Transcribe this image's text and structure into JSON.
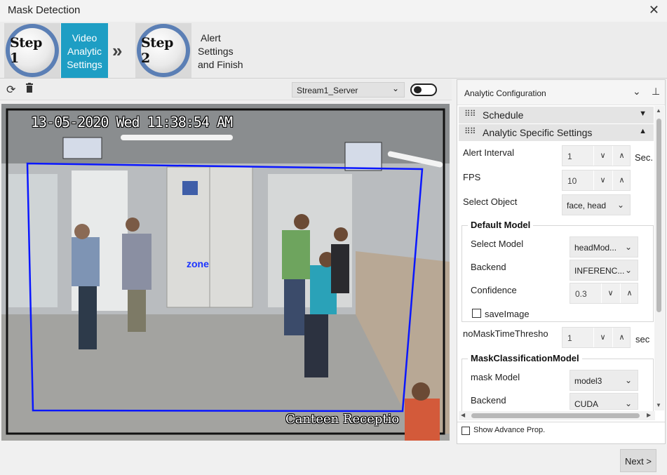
{
  "window": {
    "title": "Mask Detection"
  },
  "steps": [
    {
      "badge": "Step 1",
      "label_lines": [
        "Video",
        "Analytic",
        "Settings"
      ]
    },
    {
      "badge": "Step 2",
      "label_lines": [
        "Alert",
        "Settings",
        "and Finish"
      ]
    }
  ],
  "toolbar": {
    "stream": "Stream1_Server"
  },
  "video": {
    "timestamp": "13-05-2020 Wed 11:38:54 AM",
    "location": "Canteen Receptio",
    "zone_label": "zone",
    "colors": {
      "zone": "#0a17ff"
    }
  },
  "panel": {
    "title": "Analytic Configuration",
    "sections": {
      "schedule": "Schedule",
      "analytic_specific": "Analytic Specific Settings"
    },
    "alert_interval": {
      "label": "Alert Interval",
      "value": "1",
      "unit": "Sec."
    },
    "fps": {
      "label": "FPS",
      "value": "10"
    },
    "select_object": {
      "label": "Select Object",
      "value": "face, head"
    },
    "default_model": {
      "title": "Default Model",
      "select_model": {
        "label": "Select Model",
        "value": "headMod..."
      },
      "backend": {
        "label": "Backend",
        "value": "INFERENC..."
      },
      "confidence": {
        "label": "Confidence",
        "value": "0.3"
      },
      "save_image": {
        "label": "saveImage",
        "checked": false
      }
    },
    "no_mask_threshold": {
      "label": "noMaskTimeThresho",
      "value": "1",
      "unit": "sec"
    },
    "mask_model": {
      "title": "MaskClassificationModel",
      "mask_model": {
        "label": "mask Model",
        "value": "model3"
      },
      "backend": {
        "label": "Backend",
        "value": "CUDA"
      }
    },
    "show_advance": "Show Advance Prop."
  },
  "footer": {
    "next": "Next >"
  },
  "colors": {
    "accent": "#1e9ec4",
    "step_ring": "#5b7fb5"
  }
}
